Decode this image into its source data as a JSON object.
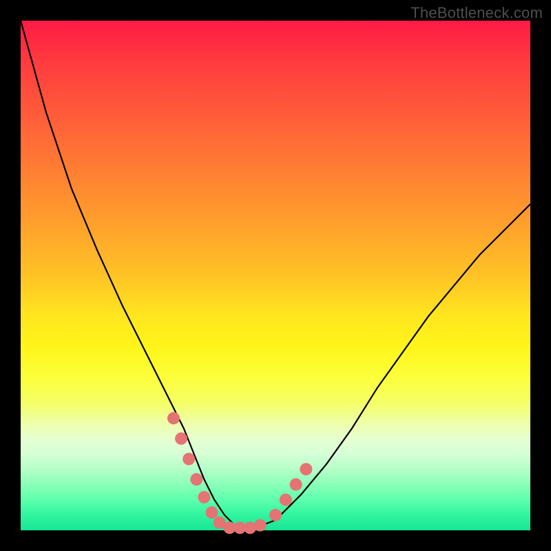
{
  "watermark": "TheBottleneck.com",
  "chart_data": {
    "type": "line",
    "title": "",
    "xlabel": "",
    "ylabel": "",
    "xlim": [
      0,
      100
    ],
    "ylim": [
      0,
      100
    ],
    "series": [
      {
        "name": "curve",
        "x": [
          0,
          5,
          10,
          15,
          20,
          25,
          30,
          32,
          34,
          36,
          38,
          40,
          42,
          44,
          46,
          50,
          55,
          60,
          65,
          70,
          75,
          80,
          85,
          90,
          95,
          100
        ],
        "y": [
          100,
          82,
          67,
          55,
          44,
          34,
          24,
          20,
          15,
          10,
          6,
          3,
          1,
          0.5,
          0.5,
          2,
          7,
          13,
          20,
          28,
          35,
          42,
          48,
          54,
          59,
          64
        ]
      }
    ],
    "markers": [
      {
        "x": 30,
        "y": 22
      },
      {
        "x": 31.5,
        "y": 18
      },
      {
        "x": 33,
        "y": 14
      },
      {
        "x": 34.5,
        "y": 10
      },
      {
        "x": 36,
        "y": 6.5
      },
      {
        "x": 37.5,
        "y": 3.5
      },
      {
        "x": 39,
        "y": 1.5
      },
      {
        "x": 41,
        "y": 0.5
      },
      {
        "x": 43,
        "y": 0.5
      },
      {
        "x": 45,
        "y": 0.5
      },
      {
        "x": 47,
        "y": 1
      },
      {
        "x": 50,
        "y": 3
      },
      {
        "x": 52,
        "y": 6
      },
      {
        "x": 54,
        "y": 9
      },
      {
        "x": 56,
        "y": 12
      }
    ],
    "marker_color": "#e57373",
    "marker_radius_px": 9
  }
}
